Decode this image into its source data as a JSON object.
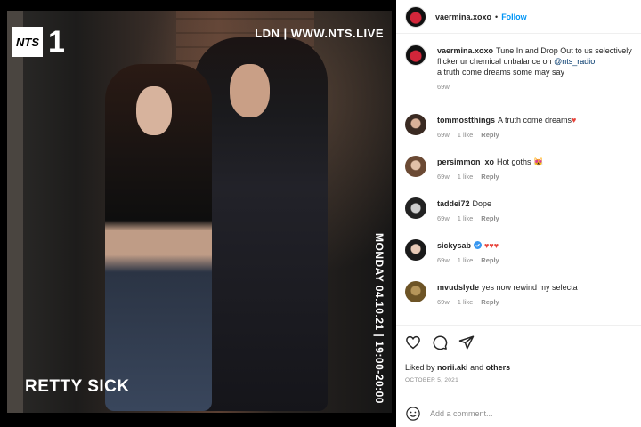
{
  "media": {
    "station_num": "1",
    "logo_text": "NTS",
    "url_text": "LDN | WWW.NTS.LIVE",
    "date_text": "MONDAY 04.10.21 | 19:00-20:00",
    "show_name": "RETTY SICK"
  },
  "header": {
    "username": "vaermina.xoxo",
    "separator": "•",
    "follow_label": "Follow"
  },
  "caption": {
    "username": "vaermina.xoxo",
    "text_1": "Tune In and Drop Out to us selectively",
    "text_2": "flicker ur chemical unbalance on",
    "mention": "@nts_radio",
    "text_3": "a truth come dreams some may say",
    "time": "69w"
  },
  "comments": [
    {
      "username": "tommostthings",
      "text": "A truth come dreams",
      "emoji": "♥",
      "time": "69w",
      "likes": "1 like",
      "reply": "Reply"
    },
    {
      "username": "persimmon_xo",
      "text": "Hot goths",
      "emoji": "😻",
      "time": "69w",
      "likes": "1 like",
      "reply": "Reply"
    },
    {
      "username": "taddei72",
      "text": "Dope",
      "emoji": "",
      "time": "69w",
      "likes": "1 like",
      "reply": "Reply"
    },
    {
      "username": "sickysab",
      "text": "",
      "emoji": "♥♥♥",
      "time": "69w",
      "likes": "1 like",
      "reply": "Reply"
    },
    {
      "username": "mvudslyde",
      "text": "yes now rewind my selecta",
      "emoji": "",
      "time": "69w",
      "likes": "1 like",
      "reply": "Reply"
    }
  ],
  "likes": {
    "prefix": "Liked by",
    "user": "norii.aki",
    "conj": "and",
    "others": "others"
  },
  "post_date": "OCTOBER 5, 2021",
  "add_comment": {
    "placeholder": "Add a comment..."
  },
  "colors": {
    "link_blue": "#0095f6",
    "heart_red": "#e8453c",
    "verified_blue": "#3897f0"
  },
  "icons": {
    "like": "heart-icon",
    "comment": "comment-icon",
    "share": "share-icon",
    "emoji": "emoji-icon"
  }
}
